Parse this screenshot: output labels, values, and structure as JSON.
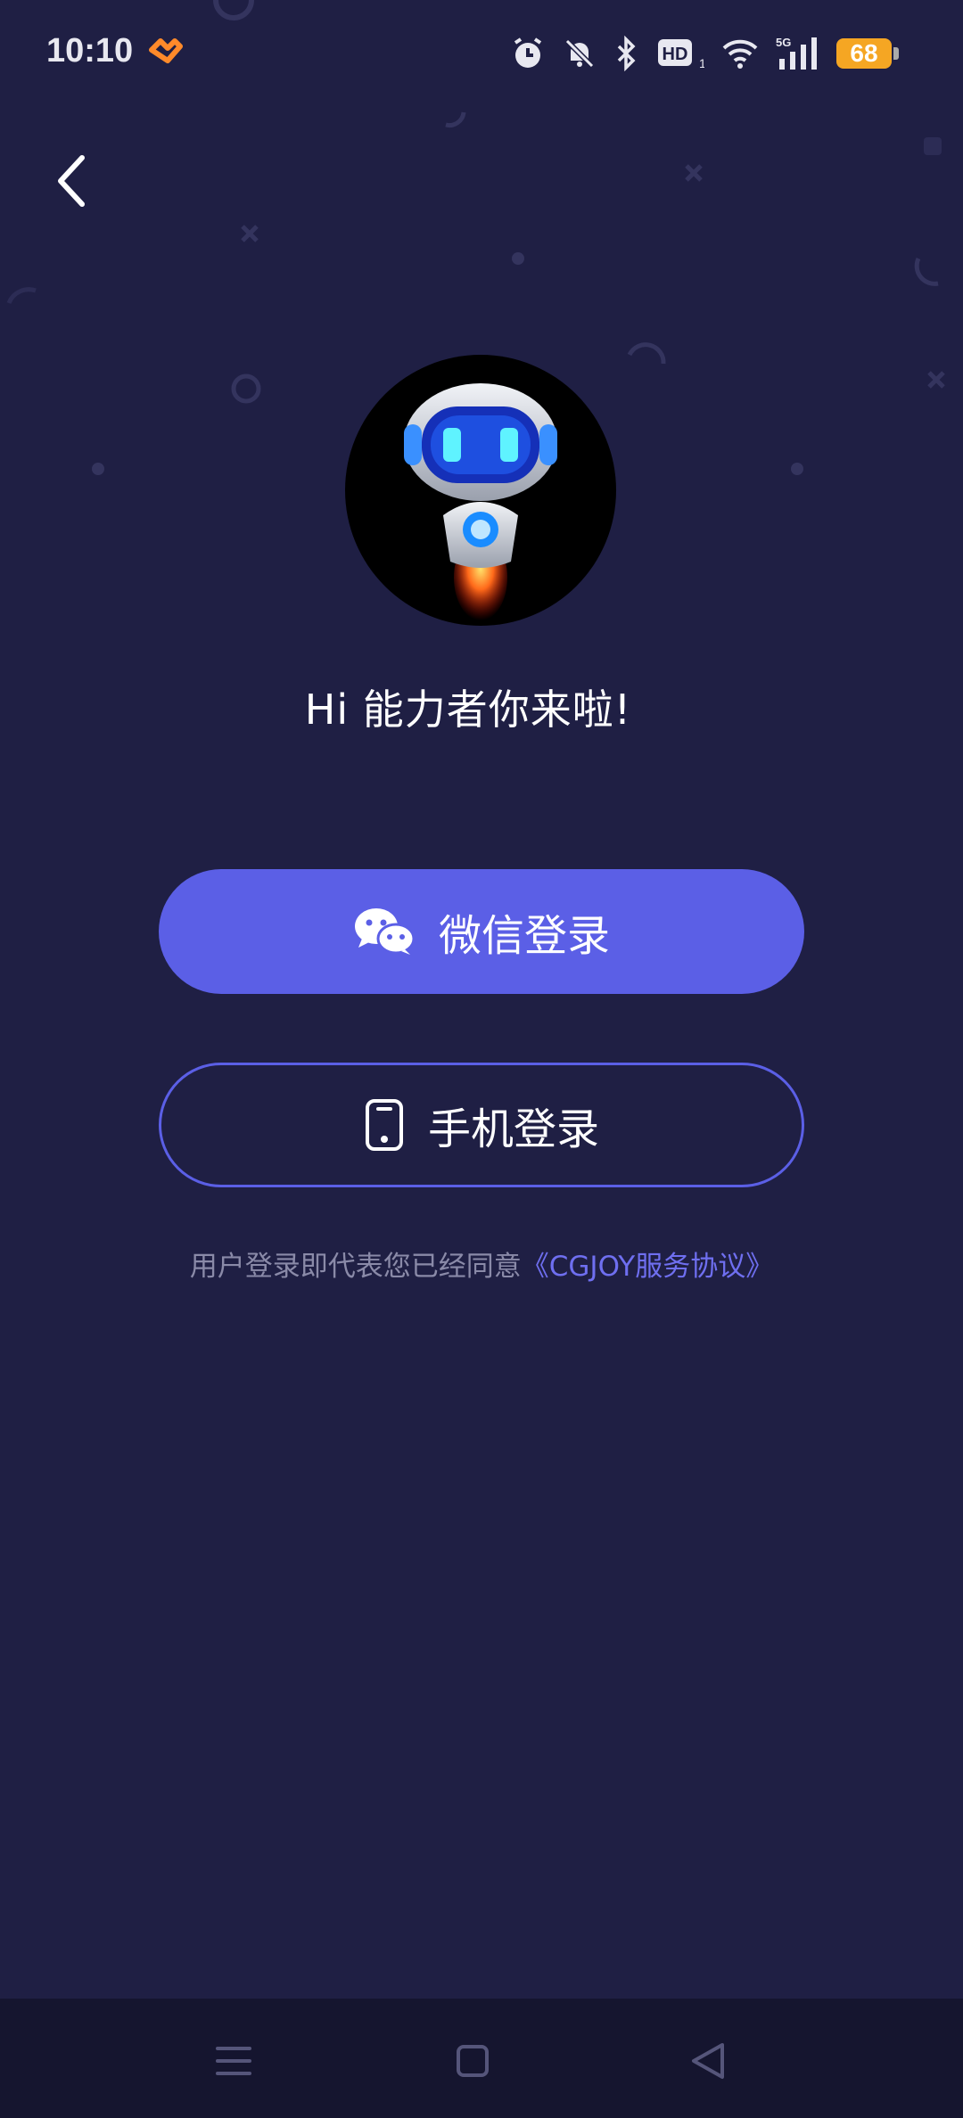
{
  "status_bar": {
    "time": "10:10",
    "battery": "68",
    "icons": [
      "app-notification-icon",
      "alarm-icon",
      "mute-icon",
      "bluetooth-icon",
      "hd-icon",
      "wifi-icon",
      "signal-5g-icon",
      "battery-icon"
    ]
  },
  "header": {
    "back_icon": "chevron-left-icon"
  },
  "main": {
    "greeting": "Hi 能力者你来啦!",
    "wechat_login_label": "微信登录",
    "phone_login_label": "手机登录",
    "agreement_text": "用户登录即代表您已经同意",
    "agreement_link": "《CGJOY服务协议》"
  },
  "nav_bar": {
    "icons": [
      "menu-icon",
      "home-icon",
      "back-triangle-icon"
    ]
  },
  "colors": {
    "background": "#1f1f44",
    "accent": "#5b5fe6",
    "link": "#6f6ff0",
    "muted_text": "#8a8aa8",
    "nav_bar": "#15152f"
  }
}
